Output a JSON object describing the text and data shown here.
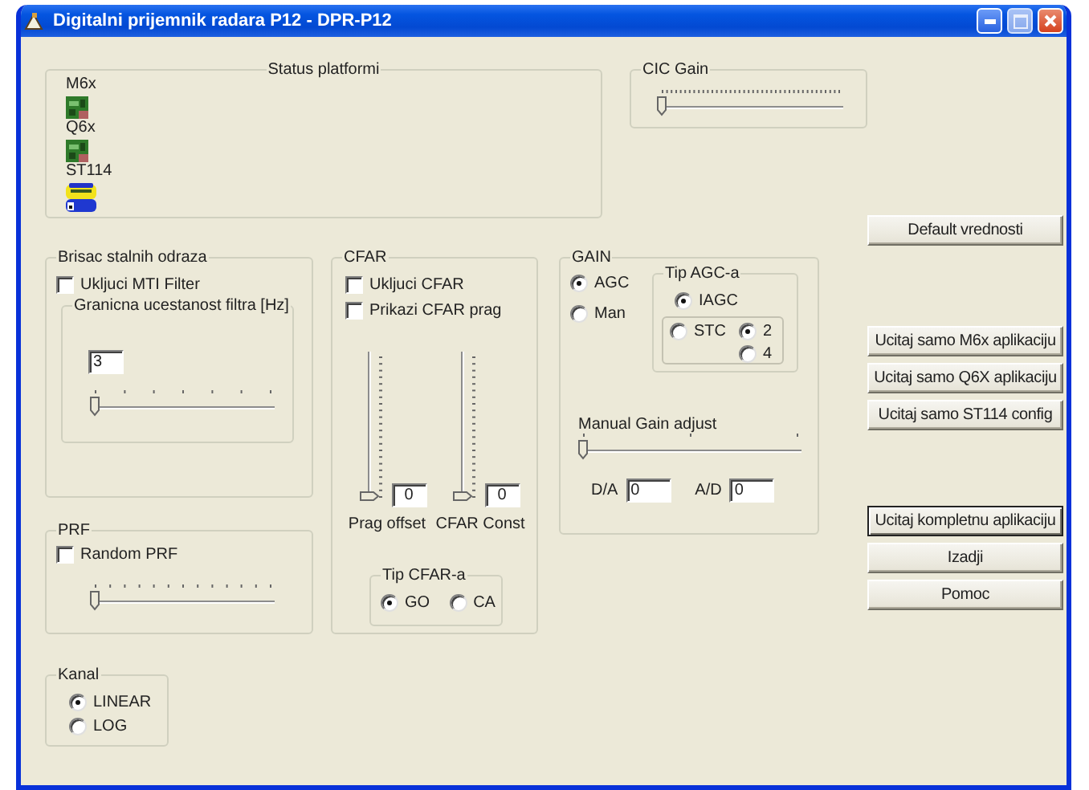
{
  "window": {
    "title": "Digitalni prijemnik radara P12 - DPR-P12"
  },
  "status_platformi": {
    "title": "Status platformi",
    "platforms": [
      {
        "label": "M6x",
        "kind": "board"
      },
      {
        "label": "Q6x",
        "kind": "board"
      },
      {
        "label": "ST114",
        "kind": "module"
      }
    ]
  },
  "cic_gain": {
    "title": "CIC Gain",
    "slider": {
      "level": 0
    }
  },
  "brisac": {
    "title": "Brisac stalnih odraza",
    "mti_filter": {
      "label": "Ukljuci MTI Filter",
      "checked": false
    },
    "granicna": {
      "title": "Granicna ucestanost filtra [Hz]",
      "value": "3",
      "slider": {
        "level": 0
      }
    }
  },
  "prf": {
    "title": "PRF",
    "random_prf": {
      "label": "Random PRF",
      "checked": false
    },
    "slider": {
      "level": 0
    }
  },
  "kanal": {
    "title": "Kanal",
    "options": [
      {
        "label": "LINEAR",
        "selected": true
      },
      {
        "label": "LOG",
        "selected": false
      }
    ]
  },
  "cfar": {
    "title": "CFAR",
    "checks": [
      {
        "label": "Ukljuci CFAR",
        "checked": false
      },
      {
        "label": "Prikazi CFAR prag",
        "checked": false
      }
    ],
    "sliders": [
      {
        "label": "Prag offset",
        "value": "0",
        "level": 0
      },
      {
        "label": "CFAR Const",
        "value": "0",
        "level": 0
      }
    ],
    "tip": {
      "title": "Tip CFAR-a",
      "options": [
        {
          "label": "GO",
          "selected": true
        },
        {
          "label": "CA",
          "selected": false
        }
      ]
    }
  },
  "gain": {
    "title": "GAIN",
    "modes": [
      {
        "label": "AGC",
        "selected": true
      },
      {
        "label": "Man",
        "selected": false
      }
    ],
    "tip_agc": {
      "title": "Tip AGC-a",
      "options": [
        {
          "label": "IAGC",
          "selected": true
        },
        {
          "label": "STC",
          "selected": false
        }
      ],
      "stc_options": [
        {
          "label": "2",
          "selected": true
        },
        {
          "label": "4",
          "selected": false
        }
      ]
    },
    "manual": {
      "title": "Manual Gain adjust",
      "level": 0
    },
    "fields": [
      {
        "label": "D/A",
        "value": "0"
      },
      {
        "label": "A/D",
        "value": "0"
      }
    ]
  },
  "button_groups": [
    [
      {
        "label": "Default vrednosti",
        "default": false
      }
    ],
    [
      {
        "label": "Ucitaj samo M6x aplikaciju",
        "default": false
      },
      {
        "label": "Ucitaj samo Q6X aplikaciju",
        "default": false
      },
      {
        "label": "Ucitaj samo ST114 config",
        "default": false
      }
    ],
    [
      {
        "label": "Ucitaj kompletnu aplikaciju",
        "default": true
      },
      {
        "label": "Izadji",
        "default": false
      },
      {
        "label": "Pomoc",
        "default": false
      }
    ]
  ]
}
